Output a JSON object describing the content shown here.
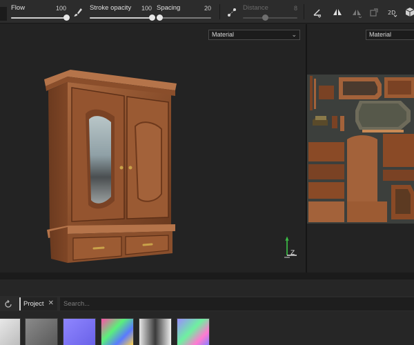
{
  "toolbar": {
    "flow": {
      "label": "Flow",
      "value": "100",
      "level": 1.0
    },
    "stroke_opacity": {
      "label": "Stroke opacity",
      "value": "100",
      "level": 1.0
    },
    "spacing": {
      "label": "Spacing",
      "value": "20",
      "level": 0.05
    },
    "distance": {
      "label": "Distance",
      "value": "8",
      "level": 0.4
    }
  },
  "viewport3d": {
    "material_select": "Material"
  },
  "viewport2d": {
    "material_select": "Material"
  },
  "shelf": {
    "tab_label": "Project",
    "search_placeholder": "Search...",
    "thumbnails": [
      "white-texture",
      "gray-texture",
      "normal-map",
      "id-map-colorful",
      "mask-texture",
      "normal-map-colorful"
    ]
  }
}
